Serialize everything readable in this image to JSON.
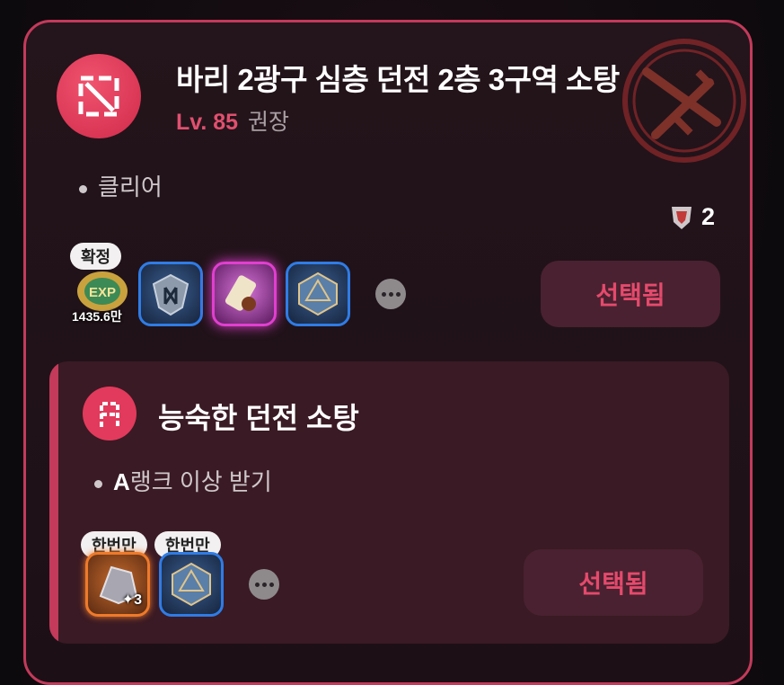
{
  "quest": {
    "title": "바리 2광구 심층 던전 2층 3구역 소탕",
    "level_label": "Lv. 85",
    "level_suffix": "권장",
    "objective": "클리어",
    "count": "2",
    "rewards": [
      {
        "icon": "exp-coin-icon",
        "tag": "확정",
        "qty": "1435.6만"
      },
      {
        "icon": "rune-crystal-icon",
        "frame": "blue"
      },
      {
        "icon": "scroll-icon",
        "frame": "purple"
      },
      {
        "icon": "d20-dice-icon",
        "frame": "blue"
      }
    ],
    "button_label": "선택됨"
  },
  "sub_quest": {
    "title": "능숙한 던전 소탕",
    "objective_rank": "A",
    "objective_rest": "랭크 이상 받기",
    "rewards": [
      {
        "icon": "ore-stone-icon",
        "frame": "orange",
        "tag": "한번만",
        "qty": "3"
      },
      {
        "icon": "d20-dice-icon",
        "frame": "blue",
        "tag": "한번만"
      }
    ],
    "button_label": "선택됨"
  },
  "colors": {
    "accent": "#c33a5b",
    "button_text": "#e44a6c",
    "button_bg": "#4a2130"
  }
}
